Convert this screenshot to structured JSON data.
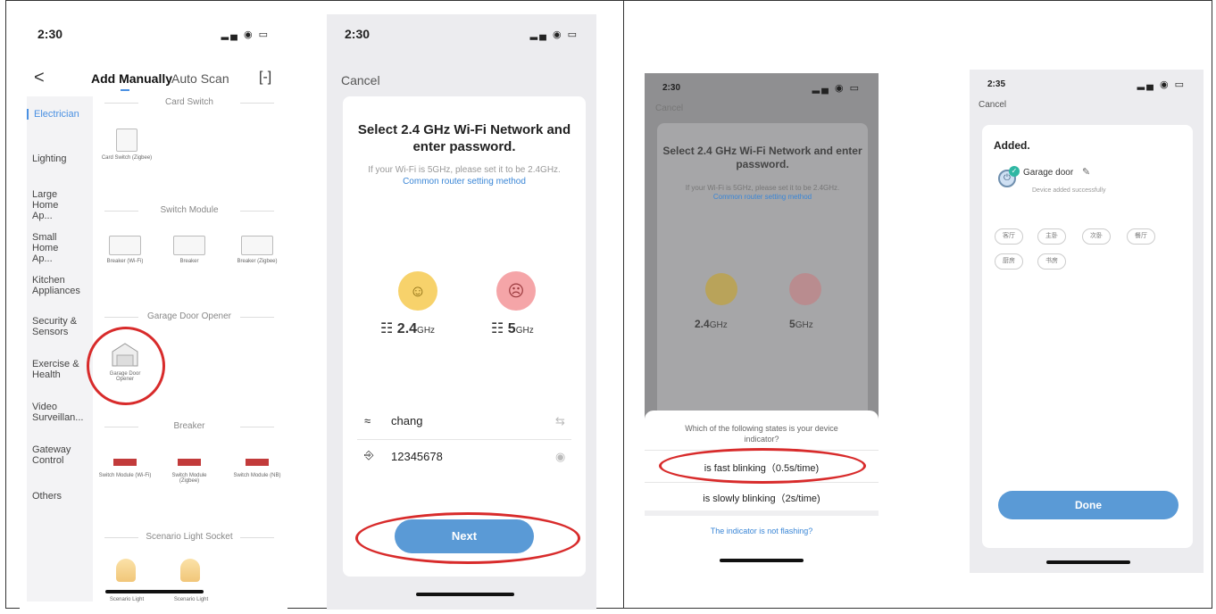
{
  "phone1": {
    "time": "2:30",
    "signal": "▂▄ ◉ ▭",
    "nav": {
      "back": "<",
      "tab_manual": "Add Manually",
      "tab_scan": "Auto Scan",
      "scan_icon": "[-]"
    },
    "sidebar": [
      "Electrician",
      "Lighting",
      "Large Home Ap...",
      "Small Home Ap...",
      "Kitchen Appliances",
      "Security & Sensors",
      "Exercise & Health",
      "Video Surveillan...",
      "Gateway Control",
      "Others"
    ],
    "sections": {
      "card_switch": "Card Switch",
      "switch_module": "Switch Module",
      "garage": "Garage Door Opener",
      "breaker": "Breaker",
      "scenario": "Scenario Light Socket"
    },
    "devices": {
      "card_switch": "Card Switch (Zigbee)",
      "breaker_wifi": "Breaker (Wi-Fi)",
      "breaker": "Breaker",
      "breaker_zigbee": "Breaker (Zigbee)",
      "garage": "Garage Door Opener",
      "sm_wifi": "Switch Module (Wi-Fi)",
      "sm_zigbee": "Switch Module (Zigbee)",
      "sm_nb": "Switch Module (NB)",
      "scenario1": "Scenario Light",
      "scenario2": "Scenario Light"
    }
  },
  "phone2": {
    "time": "2:30",
    "cancel": "Cancel",
    "title": "Select 2.4 GHz Wi-Fi Network and enter password.",
    "subtitle": "If your Wi-Fi is 5GHz, please set it to be 2.4GHz.",
    "link": "Common router setting method",
    "ghz24": "2.4",
    "ghz5": "5",
    "ghz_unit": "GHz",
    "ssid": "chang",
    "password": "12345678",
    "next": "Next"
  },
  "phone3": {
    "time": "2:30",
    "cancel": "Cancel",
    "title": "Select 2.4 GHz Wi-Fi Network and enter password.",
    "subtitle": "If your Wi-Fi is 5GHz, please set it to be 2.4GHz.",
    "link": "Common router setting method",
    "ghz24": "2.4",
    "ghz5": "5",
    "ghz_unit": "GHz",
    "question": "Which of the following states is your device indicator?",
    "fast": "is fast blinking（0.5s/time)",
    "slow": "is slowly blinking（2s/time)",
    "not_flashing": "The indicator is not flashing?"
  },
  "phone4": {
    "time": "2:35",
    "cancel": "Cancel",
    "added": "Added.",
    "device": "Garage door",
    "success": "Device added successfully",
    "rooms": [
      "客厅",
      "主卧",
      "次卧",
      "餐厅",
      "厨房",
      "书房"
    ],
    "done": "Done"
  },
  "colors": {
    "accent": "#4a90e2",
    "highlight": "#d82b2b",
    "button": "#5a9ad6"
  }
}
